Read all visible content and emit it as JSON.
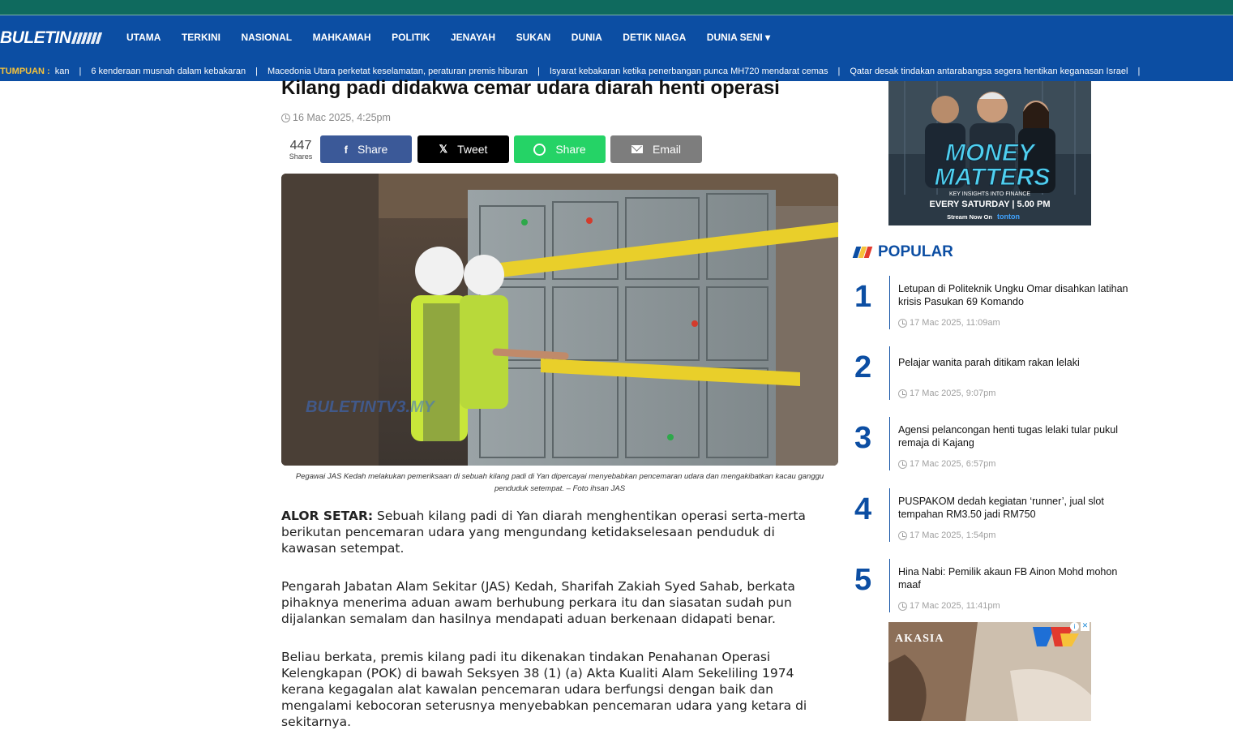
{
  "nav": {
    "logo_text": "BULETIN",
    "items": [
      "UTAMA",
      "TERKINI",
      "NASIONAL",
      "MAHKAMAH",
      "POLITIK",
      "JENAYAH",
      "SUKAN",
      "DUNIA",
      "DETIK NIAGA",
      "DUNIA SENI ▾"
    ]
  },
  "ticker": {
    "label": "TUMPUAN :",
    "items": [
      "kan",
      "6 kenderaan musnah dalam kebakaran",
      "Macedonia Utara perketat keselamatan, peraturan premis hiburan",
      "Isyarat kebakaran ketika penerbangan punca MH720 mendarat cemas",
      "Qatar desak tindakan antarabangsa segera hentikan keganasan Israel"
    ],
    "separator": "|"
  },
  "article": {
    "title": "Kilang padi didakwa cemar udara diarah henti operasi",
    "date": "16 Mac 2025, 4:25pm",
    "shares_count": "447",
    "shares_label": "Shares",
    "buttons": {
      "facebook": "Share",
      "twitter": "Tweet",
      "whatsapp": "Share",
      "email": "Email"
    },
    "image_watermark": "BULETINTV3.MY",
    "caption": "Pegawai JAS Kedah melakukan pemeriksaan di sebuah kilang padi di Yan dipercayai menyebabkan pencemaran udara dan mengakibatkan kacau ganggu penduduk setempat. – Foto ihsan JAS",
    "dateline": "ALOR SETAR:",
    "p1": " Sebuah kilang padi di Yan diarah menghentikan operasi serta-merta berikutan pencemaran udara yang mengundang ketidakselesaan penduduk di kawasan setempat.",
    "p2": "Pengarah Jabatan Alam Sekitar (JAS) Kedah, Sharifah Zakiah Syed Sahab, berkata pihaknya menerima aduan awam berhubung perkara itu dan siasatan sudah pun dijalankan semalam dan hasilnya mendapati aduan berkenaan didapati benar.",
    "p3": "Beliau berkata, premis kilang padi itu dikenakan tindakan Penahanan Operasi Kelengkapan (POK) di bawah Seksyen 38 (1) (a) Akta Kualiti Alam Sekeliling 1974 kerana kegagalan alat kawalan pencemaran udara berfungsi dengan baik dan mengalami kebocoran seterusnya menyebabkan pencemaran udara yang ketara di sekitarnya."
  },
  "ad_top": {
    "headline_1": "MONEY",
    "headline_2": "MATTERS",
    "tagline": "KEY INSIGHTS INTO FINANCE",
    "schedule": "EVERY SATURDAY | 5.00 PM",
    "stream": "Stream Now On",
    "brand": "tonton"
  },
  "popular": {
    "title": "POPULAR",
    "items": [
      {
        "num": "1",
        "title": "Letupan di Politeknik Ungku Omar disahkan latihan krisis Pasukan 69 Komando",
        "date": "17 Mac 2025, 11:09am"
      },
      {
        "num": "2",
        "title": "Pelajar wanita parah ditikam rakan lelaki",
        "date": "17 Mac 2025, 9:07pm"
      },
      {
        "num": "3",
        "title": "Agensi pelancongan henti tugas lelaki tular pukul remaja di Kajang",
        "date": "17 Mac 2025, 6:57pm"
      },
      {
        "num": "4",
        "title": "PUSPAKOM dedah kegiatan ‘runner’, jual slot tempahan RM3.50 jadi RM750",
        "date": "17 Mac 2025, 1:54pm"
      },
      {
        "num": "5",
        "title": "Hina Nabi: Pemilik akaun FB Ainon Mohd mohon maaf",
        "date": "17 Mac 2025, 11:41pm"
      }
    ]
  },
  "ad_bottom": {
    "title": "AKASIA",
    "close": "✕",
    "info": "i"
  },
  "colors": {
    "brand_blue": "#0c4ea3",
    "top_strip": "#0f6a5e",
    "ticker_label": "#f6c23a",
    "facebook": "#3b5998",
    "twitter": "#000000",
    "whatsapp": "#25d366",
    "email": "#7d7d7d"
  }
}
